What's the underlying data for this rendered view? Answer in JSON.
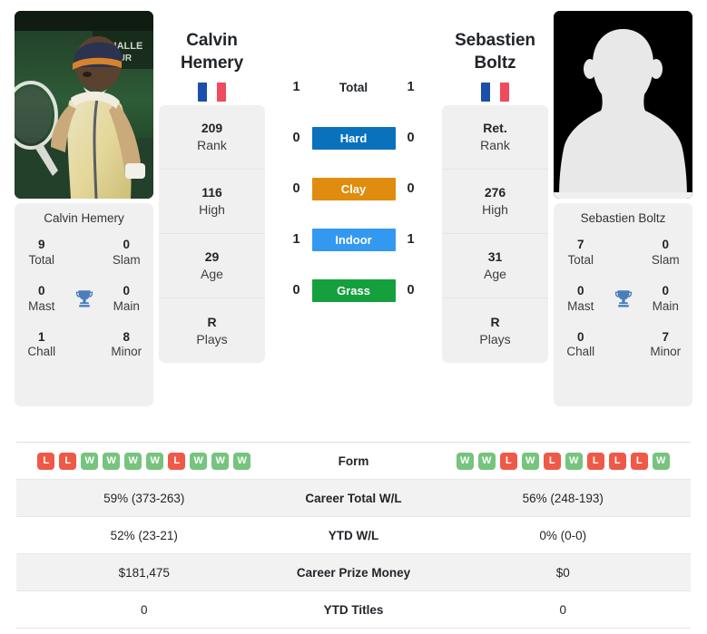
{
  "players": {
    "left": {
      "first_name": "Calvin",
      "last_name": "Hemery",
      "full_name": "Calvin Hemery",
      "country": "France",
      "photo_type": "player-photo",
      "stats": [
        {
          "value": "209",
          "label": "Rank"
        },
        {
          "value": "116",
          "label": "High"
        },
        {
          "value": "29",
          "label": "Age"
        },
        {
          "value": "R",
          "label": "Plays"
        }
      ],
      "titles": [
        {
          "value": "9",
          "label": "Total"
        },
        {
          "value": "0",
          "label": "Slam"
        },
        {
          "value": "0",
          "label": "Mast"
        },
        {
          "value": "0",
          "label": "Main"
        },
        {
          "value": "1",
          "label": "Chall"
        },
        {
          "value": "8",
          "label": "Minor"
        }
      ],
      "form": [
        "L",
        "L",
        "W",
        "W",
        "W",
        "W",
        "L",
        "W",
        "W",
        "W"
      ],
      "career_total_wl": "59% (373-263)",
      "ytd_wl": "52% (23-21)",
      "career_prize_money": "$181,475",
      "ytd_titles": "0"
    },
    "right": {
      "first_name": "Sebastien",
      "last_name": "Boltz",
      "full_name": "Sebastien Boltz",
      "country": "France",
      "photo_type": "silhouette-placeholder",
      "stats": [
        {
          "value": "Ret.",
          "label": "Rank"
        },
        {
          "value": "276",
          "label": "High"
        },
        {
          "value": "31",
          "label": "Age"
        },
        {
          "value": "R",
          "label": "Plays"
        }
      ],
      "titles": [
        {
          "value": "7",
          "label": "Total"
        },
        {
          "value": "0",
          "label": "Slam"
        },
        {
          "value": "0",
          "label": "Mast"
        },
        {
          "value": "0",
          "label": "Main"
        },
        {
          "value": "0",
          "label": "Chall"
        },
        {
          "value": "7",
          "label": "Minor"
        }
      ],
      "form": [
        "W",
        "W",
        "L",
        "W",
        "L",
        "W",
        "L",
        "L",
        "L",
        "W"
      ],
      "career_total_wl": "56% (248-193)",
      "ytd_wl": "0% (0-0)",
      "career_prize_money": "$0",
      "ytd_titles": "0"
    }
  },
  "head_to_head": [
    {
      "surface": "Total",
      "left": "1",
      "right": "1",
      "color": "transparent"
    },
    {
      "surface": "Hard",
      "left": "0",
      "right": "0",
      "color": "#0a72bd"
    },
    {
      "surface": "Clay",
      "left": "0",
      "right": "0",
      "color": "#e08c0e"
    },
    {
      "surface": "Indoor",
      "left": "1",
      "right": "1",
      "color": "#3399f0"
    },
    {
      "surface": "Grass",
      "left": "0",
      "right": "0",
      "color": "#14a03c"
    }
  ],
  "table_rows": [
    {
      "label": "Form",
      "type": "form"
    },
    {
      "label": "Career Total W/L",
      "type": "text",
      "left": "59% (373-263)",
      "right": "56% (248-193)"
    },
    {
      "label": "YTD W/L",
      "type": "text",
      "left": "52% (23-21)",
      "right": "0% (0-0)"
    },
    {
      "label": "Career Prize Money",
      "type": "text",
      "left": "$181,475",
      "right": "$0"
    },
    {
      "label": "YTD Titles",
      "type": "text",
      "left": "0",
      "right": "0"
    }
  ],
  "colors": {
    "win": "#76c47e",
    "loss": "#ee5a48",
    "hard": "#0a72bd",
    "clay": "#e08c0e",
    "indoor": "#3399f0",
    "grass": "#14a03c",
    "panel": "#f0f0f0",
    "trophy": "#4a7ebb"
  }
}
